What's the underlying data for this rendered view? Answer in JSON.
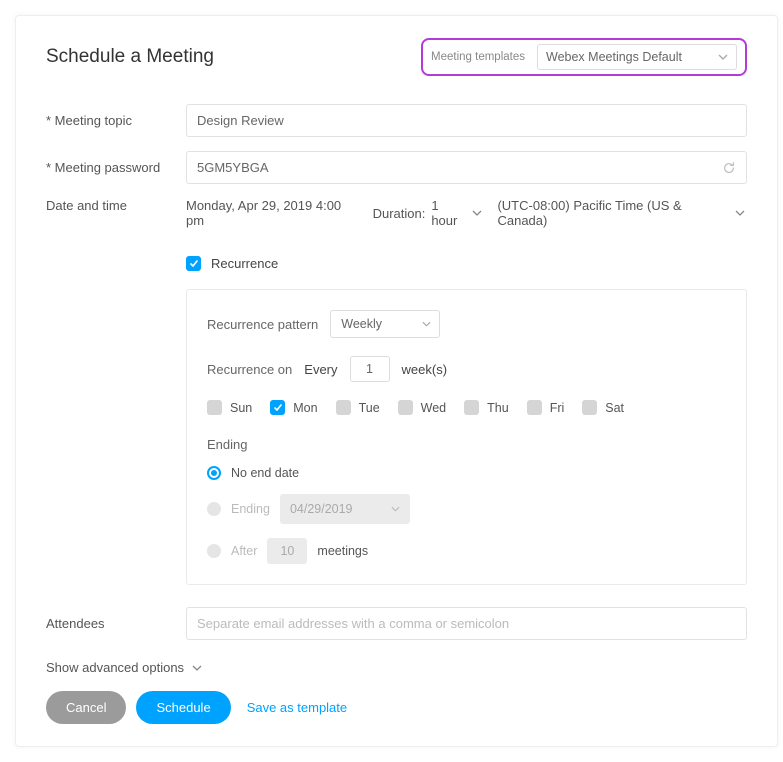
{
  "header": {
    "title": "Schedule a Meeting",
    "templates_label": "Meeting templates",
    "template_selected": "Webex Meetings Default"
  },
  "fields": {
    "topic_label": "Meeting topic",
    "topic_value": "Design Review",
    "password_label": "Meeting password",
    "password_value": "5GM5YBGA",
    "datetime_label": "Date and time",
    "datetime_value": "Monday, Apr 29, 2019 4:00 pm",
    "duration_label": "Duration:",
    "duration_value": "1 hour",
    "timezone_value": "(UTC-08:00) Pacific Time (US & Canada)"
  },
  "recurrence": {
    "toggle_label": "Recurrence",
    "pattern_label": "Recurrence pattern",
    "pattern_value": "Weekly",
    "on_label": "Recurrence on",
    "every_label": "Every",
    "every_value": "1",
    "unit": "week(s)",
    "days": [
      {
        "abbr": "Sun",
        "checked": false
      },
      {
        "abbr": "Mon",
        "checked": true
      },
      {
        "abbr": "Tue",
        "checked": false
      },
      {
        "abbr": "Wed",
        "checked": false
      },
      {
        "abbr": "Thu",
        "checked": false
      },
      {
        "abbr": "Fri",
        "checked": false
      },
      {
        "abbr": "Sat",
        "checked": false
      }
    ],
    "ending": {
      "heading": "Ending",
      "no_end_label": "No end date",
      "ending_label": "Ending",
      "ending_date": "04/29/2019",
      "after_label": "After",
      "after_value": "10",
      "after_unit": "meetings"
    }
  },
  "attendees": {
    "label": "Attendees",
    "placeholder": "Separate email addresses with a comma or semicolon"
  },
  "advanced_label": "Show advanced options",
  "buttons": {
    "cancel": "Cancel",
    "schedule": "Schedule",
    "save_template": "Save as template"
  }
}
